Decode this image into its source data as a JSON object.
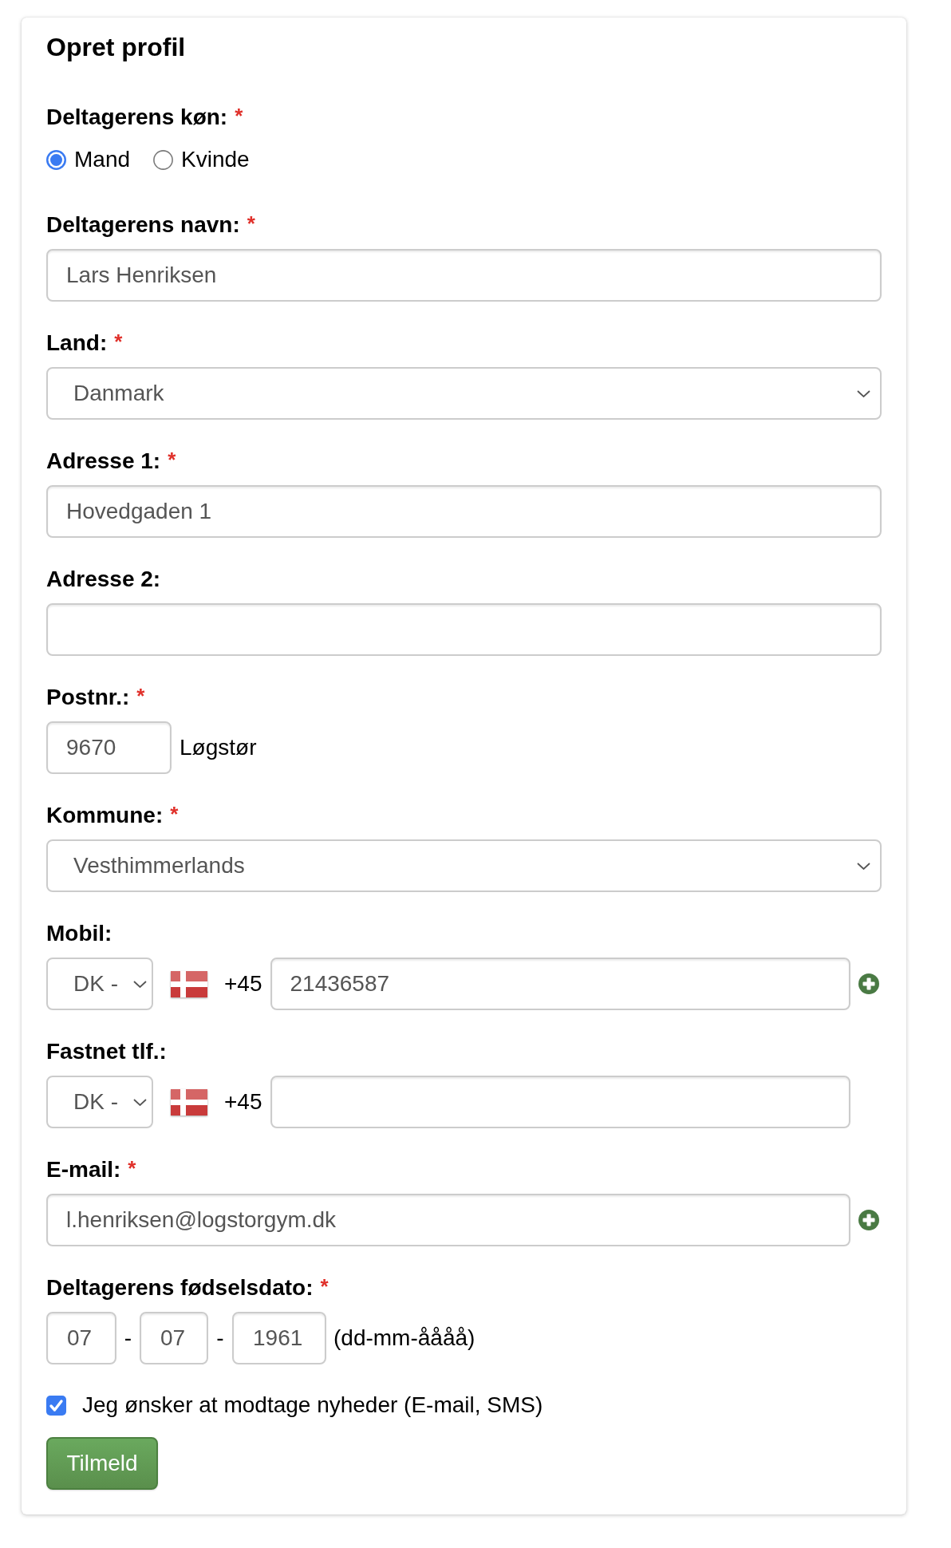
{
  "title": "Opret profil",
  "gender": {
    "label": "Deltagerens køn:",
    "required_mark": "*",
    "options": [
      {
        "label": "Mand",
        "selected": true
      },
      {
        "label": "Kvinde",
        "selected": false
      }
    ]
  },
  "fields": [
    {
      "kind": "text",
      "label": "Deltagerens navn:",
      "required_mark": "*",
      "value": "Lars Henriksen",
      "add_button": false
    },
    {
      "kind": "select",
      "label": "Land:",
      "required_mark": "*",
      "value": "Danmark"
    },
    {
      "kind": "text",
      "label": "Adresse 1:",
      "required_mark": "*",
      "value": "Hovedgaden 1",
      "add_button": false
    },
    {
      "kind": "text",
      "label": "Adresse 2:",
      "add_button": false
    },
    {
      "kind": "postal",
      "label": "Postnr.:",
      "required_mark": "*",
      "value": "9670",
      "city": "Løgstør"
    },
    {
      "kind": "select",
      "label": "Kommune:",
      "required_mark": "*",
      "value": "Vesthimmerlands"
    },
    {
      "kind": "phone",
      "label": "Mobil:",
      "country": "DK -",
      "prefix": "+45",
      "value": "21436587",
      "add_button": true
    },
    {
      "kind": "phone",
      "label": "Fastnet tlf.:",
      "country": "DK -",
      "prefix": "+45",
      "add_button": false
    },
    {
      "kind": "text",
      "label": "E-mail:",
      "required_mark": "*",
      "value": "l.henriksen@logstorgym.dk",
      "add_button": true
    },
    {
      "kind": "date",
      "label": "Deltagerens fødselsdato:",
      "required_mark": "*",
      "parts": [
        {
          "value": "07"
        },
        {
          "separator": "-",
          "value": "07"
        },
        {
          "separator": "-",
          "value": "1961"
        }
      ],
      "hint": "(dd-mm-åååå)"
    }
  ],
  "newsletter": {
    "label": "Jeg ønsker at modtage nyheder (E-mail, SMS)",
    "checked": true
  },
  "submit": "Tilmeld"
}
